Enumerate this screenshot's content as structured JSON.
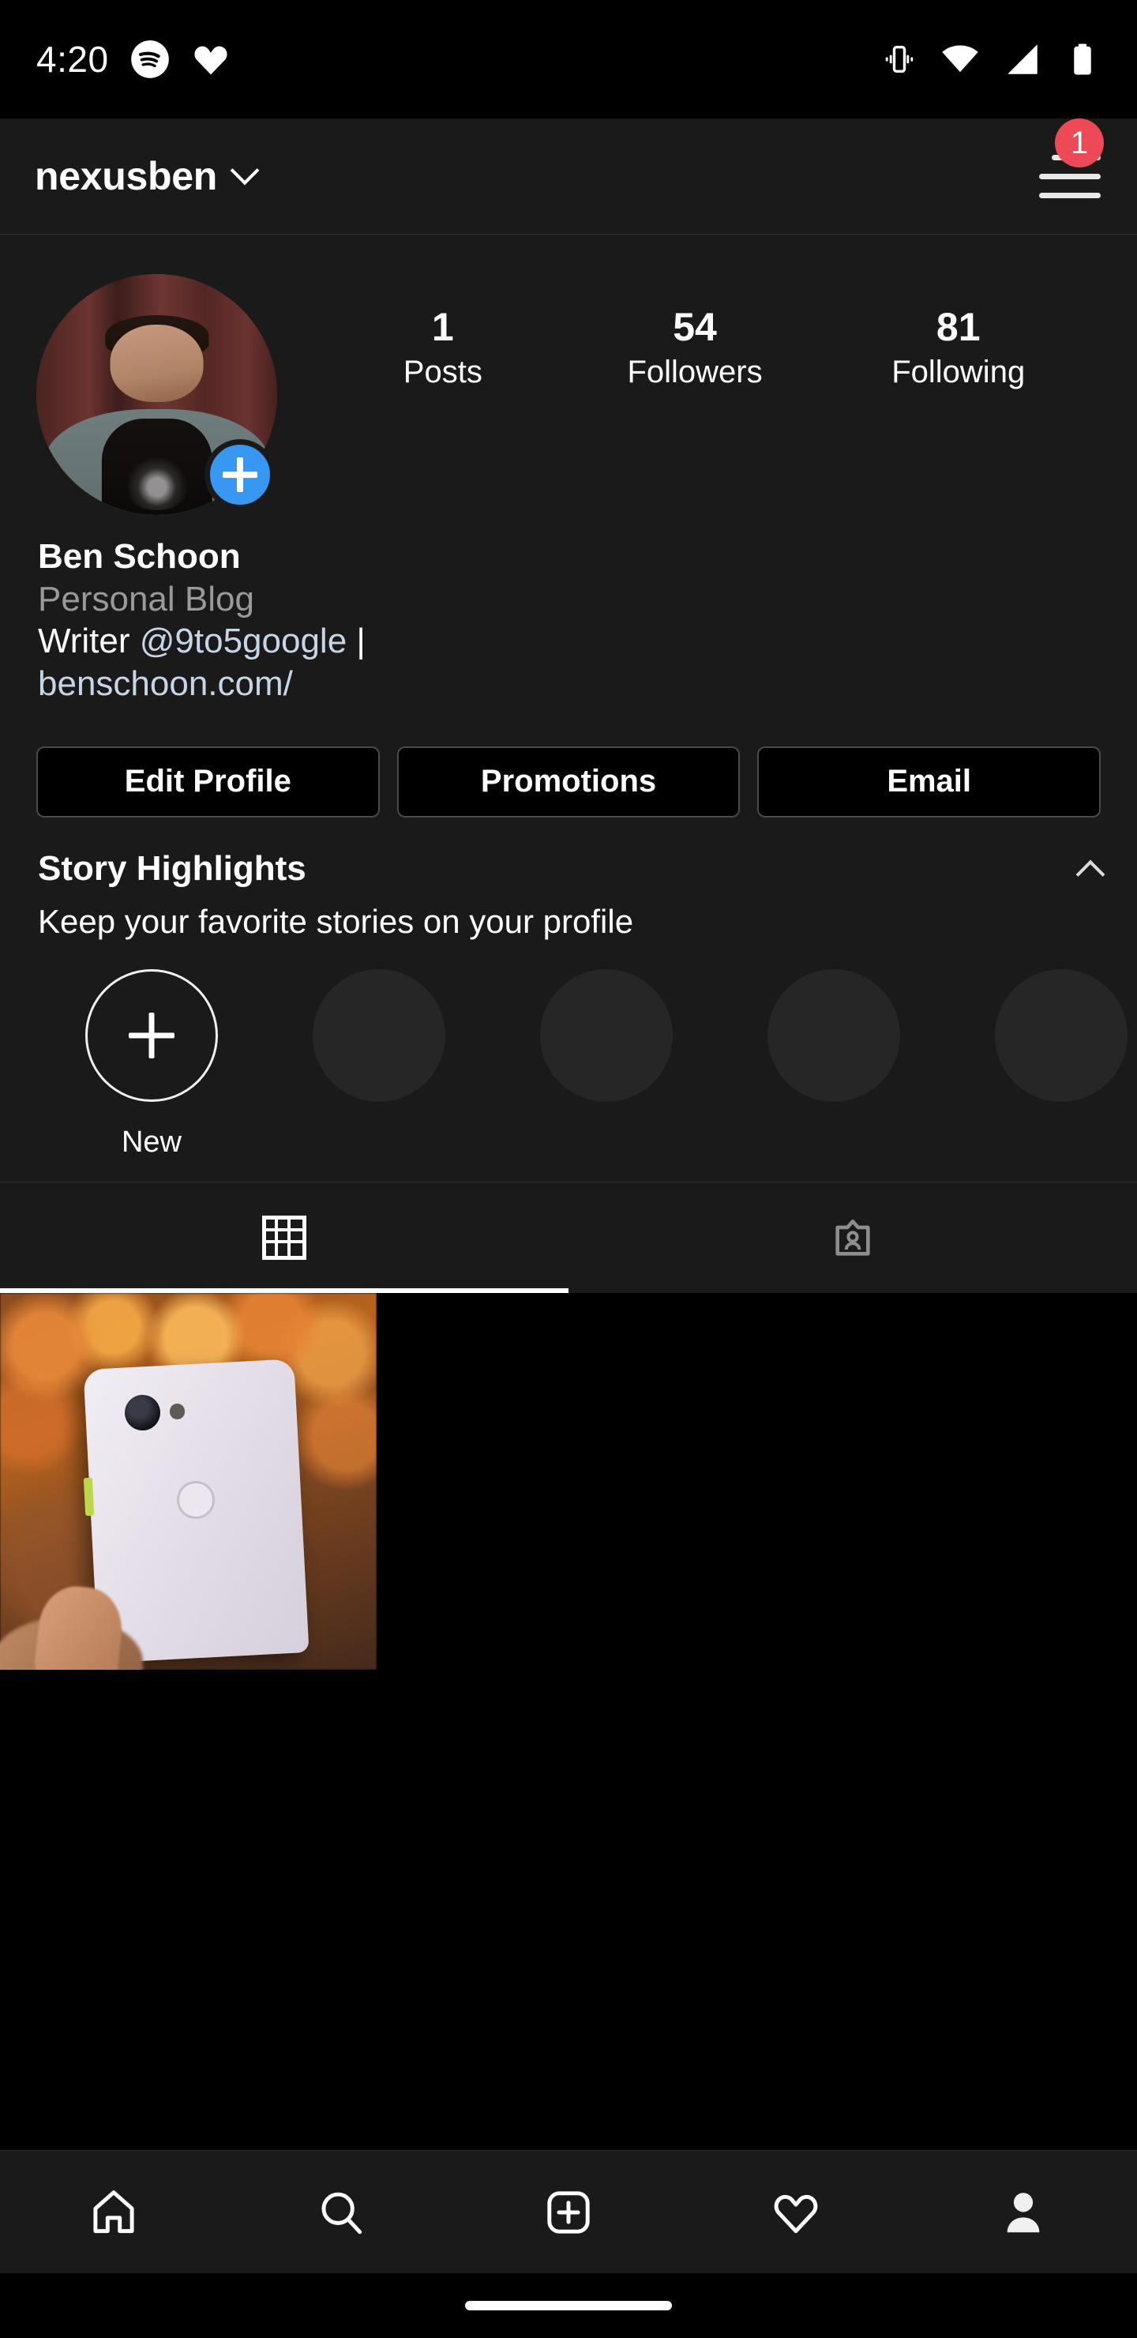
{
  "status_bar": {
    "time": "4:20",
    "left_icons": [
      "spotify-icon",
      "heart-icon"
    ],
    "right_icons": [
      "vibrate-icon",
      "wifi-icon",
      "cellular-signal-icon",
      "battery-icon"
    ]
  },
  "header": {
    "username": "nexusben",
    "dropdown_icon": "chevron-down-icon",
    "menu_icon": "hamburger-menu-icon",
    "badge_count": "1",
    "badge_color": "#ED4956"
  },
  "profile": {
    "avatar_alt": "profile-photo",
    "add_story_icon": "plus-icon",
    "add_story_color": "#3897F0",
    "stats": [
      {
        "value": "1",
        "label": "Posts"
      },
      {
        "value": "54",
        "label": "Followers"
      },
      {
        "value": "81",
        "label": "Following"
      }
    ],
    "full_name": "Ben Schoon",
    "category": "Personal Blog",
    "bio_prefix": "Writer ",
    "bio_mention": "@9to5google",
    "bio_separator": " | ",
    "bio_website": "benschoon.com/",
    "link_color": "#c7d6e6"
  },
  "actions": {
    "edit_profile": "Edit Profile",
    "promotions": "Promotions",
    "email": "Email"
  },
  "story_highlights": {
    "title": "Story Highlights",
    "collapse_icon": "chevron-up-icon",
    "subtitle": "Keep your favorite stories on your profile",
    "new_label": "New",
    "new_icon": "plus-icon",
    "placeholder_count": 4,
    "placeholder_color": "#262626"
  },
  "tabs": [
    {
      "name": "grid-tab",
      "icon": "grid-icon",
      "active": true
    },
    {
      "name": "tagged-tab",
      "icon": "tagged-person-icon",
      "active": false
    }
  ],
  "posts": [
    {
      "alt": "pixel-phone-photo",
      "has_image": true
    },
    {
      "alt": "",
      "has_image": false
    },
    {
      "alt": "",
      "has_image": false
    }
  ],
  "bottom_nav": [
    {
      "name": "home-tab",
      "icon": "home-icon",
      "active": false
    },
    {
      "name": "search-tab",
      "icon": "search-icon",
      "active": false
    },
    {
      "name": "add-post-tab",
      "icon": "add-square-icon",
      "active": false
    },
    {
      "name": "activity-tab",
      "icon": "heart-icon",
      "active": false
    },
    {
      "name": "profile-tab",
      "icon": "person-icon",
      "active": true
    }
  ]
}
